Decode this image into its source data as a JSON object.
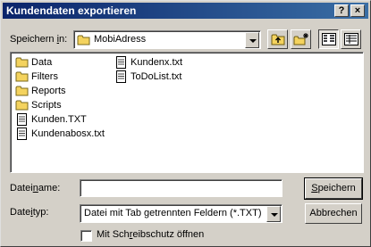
{
  "dialog": {
    "title": "Kundendaten exportieren",
    "help_label": "?",
    "close_label": "×"
  },
  "save_in": {
    "label_pre": "Speichern ",
    "label_accel": "i",
    "label_post": "n:",
    "value": "MobiAdress"
  },
  "toolbar": {
    "buttons": [
      {
        "name": "up-one-level-icon"
      },
      {
        "name": "create-new-folder-icon"
      },
      {
        "name": "list-view-icon"
      },
      {
        "name": "details-view-icon"
      }
    ]
  },
  "files": {
    "column1": [
      {
        "label": "Data",
        "type": "folder"
      },
      {
        "label": "Filters",
        "type": "folder"
      },
      {
        "label": "Reports",
        "type": "folder"
      },
      {
        "label": "Scripts",
        "type": "folder"
      },
      {
        "label": "Kunden.TXT",
        "type": "file"
      },
      {
        "label": "Kundenabosx.txt",
        "type": "file"
      }
    ],
    "column2": [
      {
        "label": "Kundenx.txt",
        "type": "file"
      },
      {
        "label": "ToDoList.txt",
        "type": "file"
      }
    ]
  },
  "filename": {
    "label_pre": "Datei",
    "label_accel": "n",
    "label_post": "ame:",
    "value": ""
  },
  "filetype": {
    "label_pre": "Date",
    "label_accel": "i",
    "label_post": "typ:",
    "value": "Datei mit Tab getrennten Feldern (*.TXT)"
  },
  "buttons": {
    "save_accel": "S",
    "save_rest": "peichern",
    "cancel": "Abbrechen"
  },
  "readonly": {
    "label_pre": "Mit Sch",
    "label_accel": "r",
    "label_post": "eibschutz öffnen",
    "checked": false
  }
}
